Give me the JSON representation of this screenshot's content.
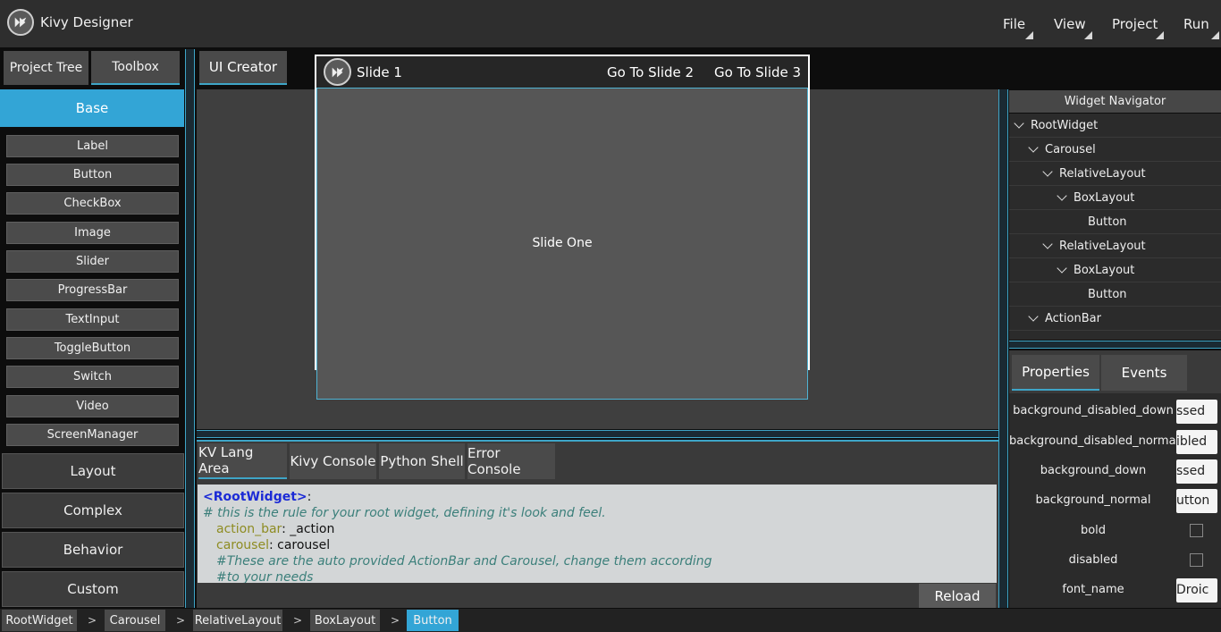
{
  "app": {
    "title": "Kivy Designer"
  },
  "menu": [
    "File",
    "View",
    "Project",
    "Run"
  ],
  "left_panel": {
    "tabs": [
      "Project Tree",
      "Toolbox"
    ],
    "active_category": "Base",
    "widgets": [
      "Label",
      "Button",
      "CheckBox",
      "Image",
      "Slider",
      "ProgressBar",
      "TextInput",
      "ToggleButton",
      "Switch",
      "Video",
      "ScreenManager"
    ],
    "categories": [
      "Layout",
      "Complex",
      "Behavior",
      "Custom"
    ]
  },
  "center": {
    "tab": "UI Creator",
    "action_bar": {
      "title": "Slide 1",
      "buttons": [
        "Go To Slide 2",
        "Go To Slide 3"
      ]
    },
    "slide_label": "Slide One"
  },
  "bottom_panel": {
    "tabs": [
      "KV Lang Area",
      "Kivy Console",
      "Python Shell",
      "Error Console"
    ],
    "code": {
      "line1_tag": "<RootWidget>",
      "line1_rest": ":",
      "line2": "# this is the rule for your root widget, defining it's look and feel.",
      "line3_key": "action_bar",
      "line3_val": ": _action",
      "line4_key": "carousel",
      "line4_val": ": carousel",
      "line5": "#These are the auto provided ActionBar and Carousel, change them according",
      "line6": "#to your needs"
    },
    "reload_label": "Reload"
  },
  "navigator": {
    "header": "Widget Navigator",
    "nodes": [
      {
        "label": "RootWidget",
        "expanded": true
      },
      {
        "label": "Carousel",
        "expanded": true
      },
      {
        "label": "RelativeLayout",
        "expanded": true
      },
      {
        "label": "BoxLayout",
        "expanded": true
      },
      {
        "label": "Button",
        "expanded": false
      },
      {
        "label": "RelativeLayout",
        "expanded": true
      },
      {
        "label": "BoxLayout",
        "expanded": true
      },
      {
        "label": "Button",
        "expanded": false
      },
      {
        "label": "ActionBar",
        "expanded": true
      }
    ]
  },
  "properties": {
    "tabs": [
      "Properties",
      "Events"
    ],
    "rows": [
      {
        "label": "background_disabled_down",
        "type": "text",
        "value": "ssed"
      },
      {
        "label": "background_disabled_normal",
        "type": "text",
        "value": "ibled"
      },
      {
        "label": "background_down",
        "type": "text",
        "value": "ssed"
      },
      {
        "label": "background_normal",
        "type": "text",
        "value": "utton"
      },
      {
        "label": "bold",
        "type": "check",
        "value": ""
      },
      {
        "label": "disabled",
        "type": "check",
        "value": ""
      },
      {
        "label": "font_name",
        "type": "text",
        "value": "Droic"
      }
    ]
  },
  "breadcrumb": {
    "items": [
      "RootWidget",
      "Carousel",
      "RelativeLayout",
      "BoxLayout",
      "Button"
    ],
    "separator": ">",
    "active": "Button"
  },
  "colors": {
    "accent": "#33a5d6",
    "panel": "#3f3f3f",
    "titlebar": "#2e2e2e"
  }
}
